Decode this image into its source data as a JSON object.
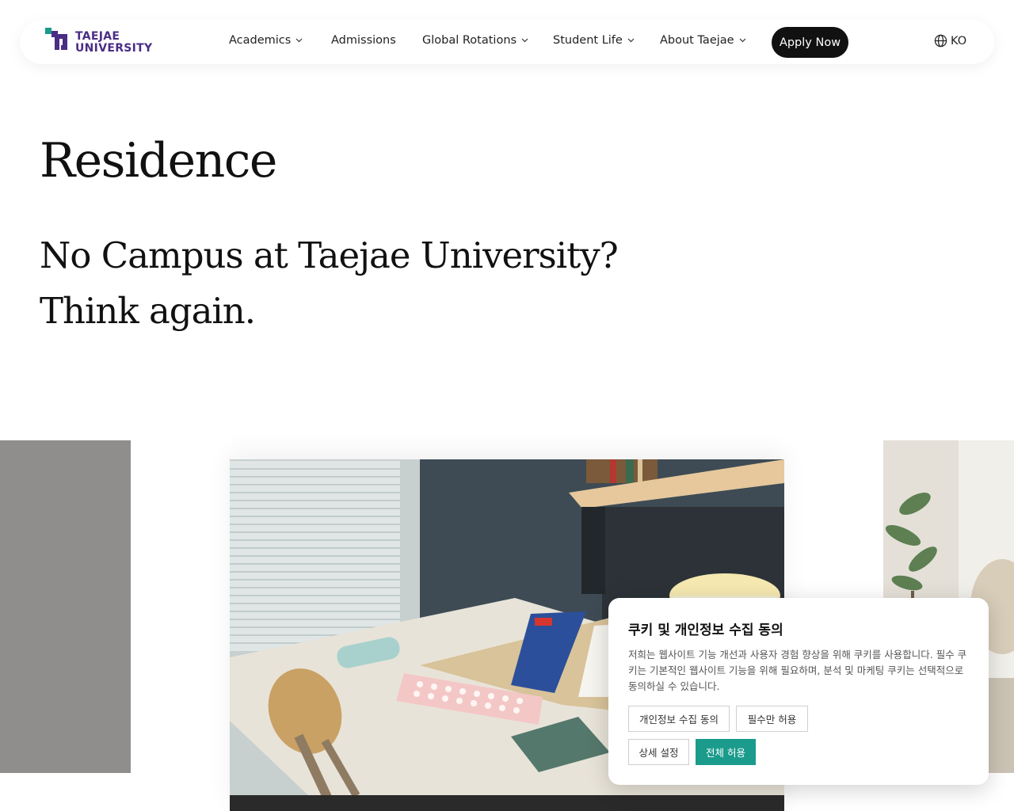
{
  "header": {
    "logo_text_line1": "TAEJAE",
    "logo_text_line2": "UNIVERSITY",
    "nav": [
      {
        "label": "Academics",
        "dropdown": true
      },
      {
        "label": "Admissions",
        "dropdown": false
      },
      {
        "label": "Global Rotations",
        "dropdown": true
      },
      {
        "label": "Student Life",
        "dropdown": true
      },
      {
        "label": "About Taejae",
        "dropdown": true
      }
    ],
    "apply_label": "Apply Now",
    "language_label": "KO"
  },
  "hero": {
    "title": "Residence",
    "subtitle_line1": "No Campus at Taejae University?",
    "subtitle_line2": "Think again."
  },
  "cookie_banner": {
    "title": "쿠키 및 개인정보 수집 동의",
    "description": "저희는 웹사이트 기능 개선과 사용자 경험 향상을 위해 쿠키를 사용합니다. 필수 쿠키는 기본적인 웹사이트 기능을 위해 필요하며, 분석 및 마케팅 쿠키는 선택적으로 동의하실 수 있습니다.",
    "buttons": {
      "privacy_consent": "개인정보 수집 동의",
      "essential_only": "필수만 허용",
      "settings": "상세 설정",
      "accept_all": "전체 허용"
    }
  },
  "colors": {
    "brand_purple": "#4a2d84",
    "brand_teal": "#1a9b8c",
    "apply_button": "#111111"
  }
}
